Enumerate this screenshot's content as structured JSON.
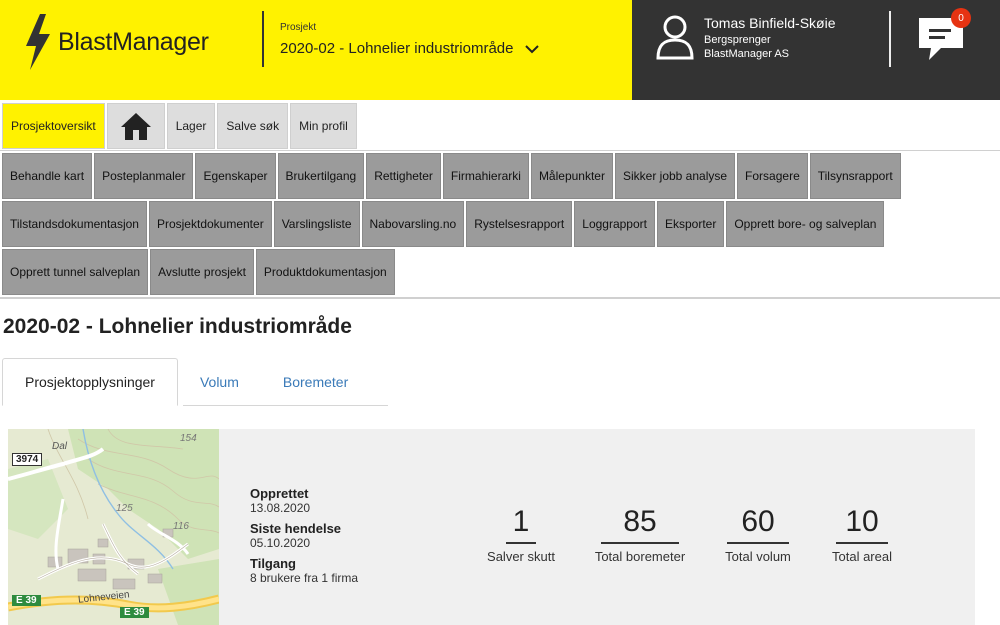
{
  "header": {
    "logo_text": "BlastManager",
    "project_label": "Prosjekt",
    "project_selected": "2020-02 - Lohnelier industriområde",
    "user": {
      "name": "Tomas Binfield-Skøie",
      "role": "Bergsprenger",
      "company": "BlastManager AS"
    },
    "chat_badge": "0",
    "colors": {
      "brand_yellow": "#fff200",
      "header_dark": "#333333",
      "badge_red": "#e63312"
    }
  },
  "topnav": {
    "items": [
      {
        "label": "Prosjektoversikt",
        "active": true
      },
      {
        "label": "",
        "icon": "home-icon"
      },
      {
        "label": "Lager"
      },
      {
        "label": "Salve søk"
      },
      {
        "label": "Min profil"
      }
    ]
  },
  "functions": {
    "row1": [
      "Behandle kart",
      "Posteplanmaler",
      "Egenskaper",
      "Brukertilgang",
      "Rettigheter",
      "Firmahierarki",
      "Målepunkter",
      "Sikker jobb analyse",
      "Forsagere",
      "Tilsynsrapport"
    ],
    "row2": [
      "Tilstandsdokumentasjon",
      "Prosjektdokumenter",
      "Varslingsliste",
      "Nabovarsling.no",
      "Rystelsesrapport",
      "Loggrapport",
      "Eksporter",
      "Opprett bore- og salveplan"
    ],
    "row3": [
      "Opprett tunnel salveplan",
      "Avslutte prosjekt",
      "Produktdokumentasjon"
    ]
  },
  "page_title": "2020-02 - Lohnelier industriområde",
  "tabs": [
    {
      "label": "Prosjektopplysninger",
      "active": true
    },
    {
      "label": "Volum"
    },
    {
      "label": "Boremeter"
    }
  ],
  "map": {
    "labels": {
      "road_3974": "3974",
      "dal": "Dal",
      "h154": "154",
      "h125": "125",
      "h116": "116",
      "e39_a": "E 39",
      "e39_b": "E 39",
      "street": "Lohneveien"
    }
  },
  "info": {
    "created_label": "Opprettet",
    "created_value": "13.08.2020",
    "last_event_label": "Siste hendelse",
    "last_event_value": "05.10.2020",
    "access_label": "Tilgang",
    "access_value": "8 brukere fra 1 firma"
  },
  "stats": [
    {
      "value": "1",
      "label": "Salver skutt"
    },
    {
      "value": "85",
      "label": "Total boremeter"
    },
    {
      "value": "60",
      "label": "Total volum"
    },
    {
      "value": "10",
      "label": "Total areal"
    }
  ]
}
